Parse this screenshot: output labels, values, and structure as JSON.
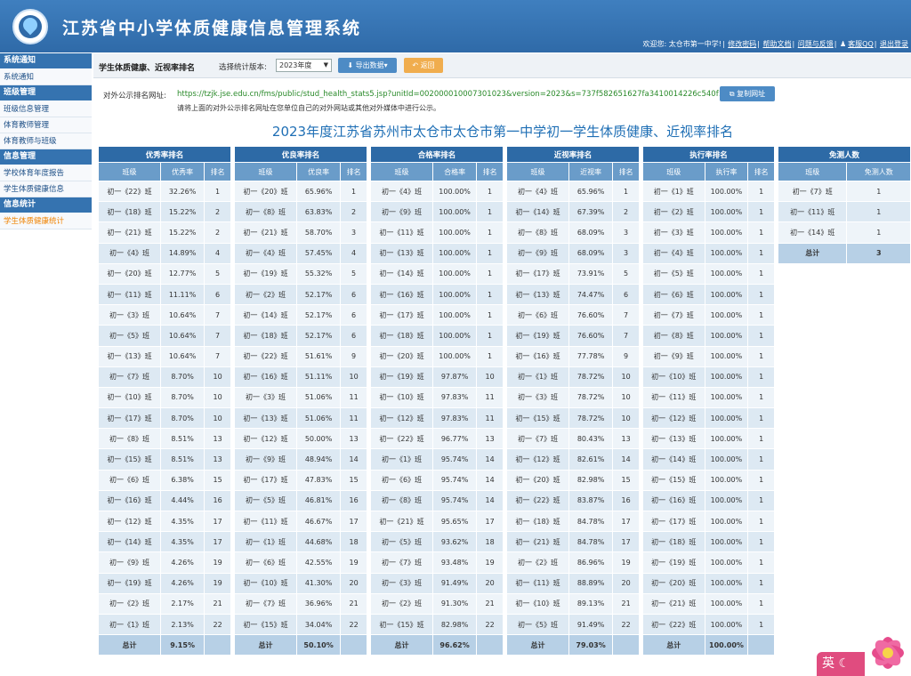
{
  "header": {
    "title": "江苏省中小学体质健康信息管理系统",
    "welcome": "欢迎您: 太仓市第一中学!",
    "links": [
      "修改密码",
      "帮助文档",
      "问题与反馈",
      "客服QQ",
      "退出登录"
    ]
  },
  "sidebar": [
    {
      "group": "系统通知",
      "items": [
        {
          "label": "系统通知",
          "active": false
        }
      ]
    },
    {
      "group": "班级管理",
      "items": [
        {
          "label": "班级信息管理",
          "active": false
        },
        {
          "label": "体育教师管理",
          "active": false
        },
        {
          "label": "体育教师与班级",
          "active": false
        }
      ]
    },
    {
      "group": "信息管理",
      "items": [
        {
          "label": "学校体育年度报告",
          "active": false
        },
        {
          "label": "学生体质健康信息",
          "active": false
        }
      ]
    },
    {
      "group": "信息统计",
      "items": [
        {
          "label": "学生体质健康统计",
          "active": true
        }
      ]
    }
  ],
  "toolbar": {
    "heading": "学生体质健康、近视率排名",
    "version_label": "选择统计版本:",
    "version_value": "2023年度",
    "export_label": "导出数据",
    "back_label": "返回"
  },
  "url": {
    "label": "对外公示排名网址:",
    "value": "https://tzjk.jse.edu.cn/fms/public/stud_health_stats5.jsp?unitId=002000010007301023&version=2023&s=737f582651627fa3410014226c540f19",
    "copy_label": "复制网址",
    "note": "请将上面的对外公示排名网址在您单位自己的对外网站或其他对外媒体中进行公示。"
  },
  "main_title": "2023年度江苏省苏州市太仓市太仓市第一中学初一学生体质健康、近视率排名",
  "tables": [
    {
      "id": "excellent",
      "caption": "优秀率排名",
      "headers": [
        "班级",
        "优秀率",
        "排名"
      ],
      "rows": [
        [
          "初一《22》班",
          "32.26%",
          "1"
        ],
        [
          "初一《18》班",
          "15.22%",
          "2"
        ],
        [
          "初一《21》班",
          "15.22%",
          "2"
        ],
        [
          "初一《4》班",
          "14.89%",
          "4"
        ],
        [
          "初一《20》班",
          "12.77%",
          "5"
        ],
        [
          "初一《11》班",
          "11.11%",
          "6"
        ],
        [
          "初一《3》班",
          "10.64%",
          "7"
        ],
        [
          "初一《5》班",
          "10.64%",
          "7"
        ],
        [
          "初一《13》班",
          "10.64%",
          "7"
        ],
        [
          "初一《7》班",
          "8.70%",
          "10"
        ],
        [
          "初一《10》班",
          "8.70%",
          "10"
        ],
        [
          "初一《17》班",
          "8.70%",
          "10"
        ],
        [
          "初一《8》班",
          "8.51%",
          "13"
        ],
        [
          "初一《15》班",
          "8.51%",
          "13"
        ],
        [
          "初一《6》班",
          "6.38%",
          "15"
        ],
        [
          "初一《16》班",
          "4.44%",
          "16"
        ],
        [
          "初一《12》班",
          "4.35%",
          "17"
        ],
        [
          "初一《14》班",
          "4.35%",
          "17"
        ],
        [
          "初一《9》班",
          "4.26%",
          "19"
        ],
        [
          "初一《19》班",
          "4.26%",
          "19"
        ],
        [
          "初一《2》班",
          "2.17%",
          "21"
        ],
        [
          "初一《1》班",
          "2.13%",
          "22"
        ]
      ],
      "total": [
        "总计",
        "9.15%",
        ""
      ]
    },
    {
      "id": "good",
      "caption": "优良率排名",
      "headers": [
        "班级",
        "优良率",
        "排名"
      ],
      "rows": [
        [
          "初一《20》班",
          "65.96%",
          "1"
        ],
        [
          "初一《8》班",
          "63.83%",
          "2"
        ],
        [
          "初一《21》班",
          "58.70%",
          "3"
        ],
        [
          "初一《4》班",
          "57.45%",
          "4"
        ],
        [
          "初一《19》班",
          "55.32%",
          "5"
        ],
        [
          "初一《2》班",
          "52.17%",
          "6"
        ],
        [
          "初一《14》班",
          "52.17%",
          "6"
        ],
        [
          "初一《18》班",
          "52.17%",
          "6"
        ],
        [
          "初一《22》班",
          "51.61%",
          "9"
        ],
        [
          "初一《16》班",
          "51.11%",
          "10"
        ],
        [
          "初一《3》班",
          "51.06%",
          "11"
        ],
        [
          "初一《13》班",
          "51.06%",
          "11"
        ],
        [
          "初一《12》班",
          "50.00%",
          "13"
        ],
        [
          "初一《9》班",
          "48.94%",
          "14"
        ],
        [
          "初一《17》班",
          "47.83%",
          "15"
        ],
        [
          "初一《5》班",
          "46.81%",
          "16"
        ],
        [
          "初一《11》班",
          "46.67%",
          "17"
        ],
        [
          "初一《1》班",
          "44.68%",
          "18"
        ],
        [
          "初一《6》班",
          "42.55%",
          "19"
        ],
        [
          "初一《10》班",
          "41.30%",
          "20"
        ],
        [
          "初一《7》班",
          "36.96%",
          "21"
        ],
        [
          "初一《15》班",
          "34.04%",
          "22"
        ]
      ],
      "total": [
        "总计",
        "50.10%",
        ""
      ]
    },
    {
      "id": "pass",
      "caption": "合格率排名",
      "headers": [
        "班级",
        "合格率",
        "排名"
      ],
      "rows": [
        [
          "初一《4》班",
          "100.00%",
          "1"
        ],
        [
          "初一《9》班",
          "100.00%",
          "1"
        ],
        [
          "初一《11》班",
          "100.00%",
          "1"
        ],
        [
          "初一《13》班",
          "100.00%",
          "1"
        ],
        [
          "初一《14》班",
          "100.00%",
          "1"
        ],
        [
          "初一《16》班",
          "100.00%",
          "1"
        ],
        [
          "初一《17》班",
          "100.00%",
          "1"
        ],
        [
          "初一《18》班",
          "100.00%",
          "1"
        ],
        [
          "初一《20》班",
          "100.00%",
          "1"
        ],
        [
          "初一《19》班",
          "97.87%",
          "10"
        ],
        [
          "初一《10》班",
          "97.83%",
          "11"
        ],
        [
          "初一《12》班",
          "97.83%",
          "11"
        ],
        [
          "初一《22》班",
          "96.77%",
          "13"
        ],
        [
          "初一《1》班",
          "95.74%",
          "14"
        ],
        [
          "初一《6》班",
          "95.74%",
          "14"
        ],
        [
          "初一《8》班",
          "95.74%",
          "14"
        ],
        [
          "初一《21》班",
          "95.65%",
          "17"
        ],
        [
          "初一《5》班",
          "93.62%",
          "18"
        ],
        [
          "初一《7》班",
          "93.48%",
          "19"
        ],
        [
          "初一《3》班",
          "91.49%",
          "20"
        ],
        [
          "初一《2》班",
          "91.30%",
          "21"
        ],
        [
          "初一《15》班",
          "82.98%",
          "22"
        ]
      ],
      "total": [
        "总计",
        "96.62%",
        ""
      ]
    },
    {
      "id": "myopia",
      "caption": "近视率排名",
      "headers": [
        "班级",
        "近视率",
        "排名"
      ],
      "rows": [
        [
          "初一《4》班",
          "65.96%",
          "1"
        ],
        [
          "初一《14》班",
          "67.39%",
          "2"
        ],
        [
          "初一《8》班",
          "68.09%",
          "3"
        ],
        [
          "初一《9》班",
          "68.09%",
          "3"
        ],
        [
          "初一《17》班",
          "73.91%",
          "5"
        ],
        [
          "初一《13》班",
          "74.47%",
          "6"
        ],
        [
          "初一《6》班",
          "76.60%",
          "7"
        ],
        [
          "初一《19》班",
          "76.60%",
          "7"
        ],
        [
          "初一《16》班",
          "77.78%",
          "9"
        ],
        [
          "初一《1》班",
          "78.72%",
          "10"
        ],
        [
          "初一《3》班",
          "78.72%",
          "10"
        ],
        [
          "初一《15》班",
          "78.72%",
          "10"
        ],
        [
          "初一《7》班",
          "80.43%",
          "13"
        ],
        [
          "初一《12》班",
          "82.61%",
          "14"
        ],
        [
          "初一《20》班",
          "82.98%",
          "15"
        ],
        [
          "初一《22》班",
          "83.87%",
          "16"
        ],
        [
          "初一《18》班",
          "84.78%",
          "17"
        ],
        [
          "初一《21》班",
          "84.78%",
          "17"
        ],
        [
          "初一《2》班",
          "86.96%",
          "19"
        ],
        [
          "初一《11》班",
          "88.89%",
          "20"
        ],
        [
          "初一《10》班",
          "89.13%",
          "21"
        ],
        [
          "初一《5》班",
          "91.49%",
          "22"
        ]
      ],
      "total": [
        "总计",
        "79.03%",
        ""
      ]
    },
    {
      "id": "exec",
      "caption": "执行率排名",
      "headers": [
        "班级",
        "执行率",
        "排名"
      ],
      "rows": [
        [
          "初一《1》班",
          "100.00%",
          "1"
        ],
        [
          "初一《2》班",
          "100.00%",
          "1"
        ],
        [
          "初一《3》班",
          "100.00%",
          "1"
        ],
        [
          "初一《4》班",
          "100.00%",
          "1"
        ],
        [
          "初一《5》班",
          "100.00%",
          "1"
        ],
        [
          "初一《6》班",
          "100.00%",
          "1"
        ],
        [
          "初一《7》班",
          "100.00%",
          "1"
        ],
        [
          "初一《8》班",
          "100.00%",
          "1"
        ],
        [
          "初一《9》班",
          "100.00%",
          "1"
        ],
        [
          "初一《10》班",
          "100.00%",
          "1"
        ],
        [
          "初一《11》班",
          "100.00%",
          "1"
        ],
        [
          "初一《12》班",
          "100.00%",
          "1"
        ],
        [
          "初一《13》班",
          "100.00%",
          "1"
        ],
        [
          "初一《14》班",
          "100.00%",
          "1"
        ],
        [
          "初一《15》班",
          "100.00%",
          "1"
        ],
        [
          "初一《16》班",
          "100.00%",
          "1"
        ],
        [
          "初一《17》班",
          "100.00%",
          "1"
        ],
        [
          "初一《18》班",
          "100.00%",
          "1"
        ],
        [
          "初一《19》班",
          "100.00%",
          "1"
        ],
        [
          "初一《20》班",
          "100.00%",
          "1"
        ],
        [
          "初一《21》班",
          "100.00%",
          "1"
        ],
        [
          "初一《22》班",
          "100.00%",
          "1"
        ]
      ],
      "total": [
        "总计",
        "100.00%",
        ""
      ]
    },
    {
      "id": "exempt",
      "caption": "免测人数",
      "headers": [
        "班级",
        "免测人数"
      ],
      "rows": [
        [
          "初一《7》班",
          "1"
        ],
        [
          "初一《11》班",
          "1"
        ],
        [
          "初一《14》班",
          "1"
        ]
      ],
      "total": [
        "总计",
        "3"
      ]
    }
  ],
  "ime": {
    "label": "英"
  }
}
